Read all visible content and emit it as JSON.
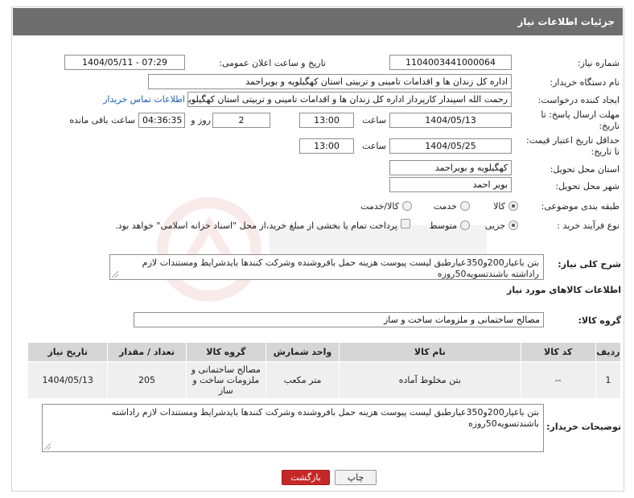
{
  "header": {
    "title": "جزئیات اطلاعات نیاز"
  },
  "form": {
    "need_number_label": "شماره نیاز:",
    "need_number": "1104003441000064",
    "announce_label": "تاریخ و ساعت اعلان عمومی:",
    "announce_value": "1404/05/11 - 07:29",
    "buyer_org_label": "نام دستگاه خریدار:",
    "buyer_org": "اداره کل زندان ها و اقدامات تامینی و تربیتی استان کهگیلویه و بویراحمد",
    "creator_label": "ایجاد کننده درخواست:",
    "creator": "رحمت الله اسپندار کارپرداز اداره کل زندان ها و اقدامات تامینی و تربیتی استان کهگیلویه و بویراحمد",
    "contact_link": "اطلاعات تماس خریدار",
    "deadline_label_1": "مهلت ارسال پاسخ: تا",
    "deadline_label_2": "تاریخ:",
    "deadline_date": "1404/05/13",
    "time_label": "ساعت",
    "deadline_time": "13:00",
    "days_value": "2",
    "days_label": "روز و",
    "remaining_value": "04:36:35",
    "remaining_label": "ساعت باقی مانده",
    "validity_label_1": "حداقل تاریخ اعتبار قیمت:",
    "validity_label_2": "تا تاریخ:",
    "validity_date": "1404/05/25",
    "validity_time": "13:00",
    "province_label": "استان محل تحویل:",
    "province": "کهگیلویه و بویراحمد",
    "city_label": "شهر محل تحویل:",
    "city": "بویر احمد",
    "category_label": "طبقه بندی موضوعی:",
    "category_options": [
      "کالا",
      "خدمت",
      "کالا/خدمت"
    ],
    "category_selected": "کالا",
    "process_label": "نوع فرآیند خرید :",
    "process_options": [
      "جزیی",
      "متوسط"
    ],
    "process_selected": "جزیی",
    "payment_note": "پرداخت تمام یا بخشی از مبلغ خرید،از محل \"اسناد خزانه اسلامی\" خواهد بود."
  },
  "description": {
    "label": "شرح کلی نیاز:",
    "text": "بتن باعیار200و350عیارطبق لیست پیوست هزینه حمل بافروشنده وشرکت کنندها بایدشرایط ومستندات لازم راداشته باشندتسویه50روزه"
  },
  "goods": {
    "section_title": "اطلاعات کالاهای مورد نیاز",
    "group_label": "گروه کالا:",
    "group_value": "مصالح ساختمانی و ملزومات ساخت و ساز",
    "columns": [
      "ردیف",
      "کد کالا",
      "نام کالا",
      "واحد شمارش",
      "گروه کالا",
      "تعداد / مقدار",
      "تاریخ نیاز"
    ],
    "rows": [
      {
        "row": "1",
        "code": "--",
        "name": "بتن مخلوط آماده",
        "unit": "متر مکعب",
        "group": "مصالح ساختمانی و ملزومات ساخت و ساز",
        "qty": "205",
        "date": "1404/05/13"
      }
    ]
  },
  "buyer_notes": {
    "label": "توضیحات خریدار:",
    "text": "بتن باعیار200و350عیارطبق لیست پیوست هزینه حمل بافروشنده وشرکت کنندها بایدشرایط ومستندات لازم راداشته باشندتسویه50روزه"
  },
  "buttons": {
    "print": "چاپ",
    "back": "بازگشت"
  },
  "colors": {
    "header_bg": "#6e6e6e",
    "back_button": "#c62828",
    "link": "#1a5fb4"
  }
}
